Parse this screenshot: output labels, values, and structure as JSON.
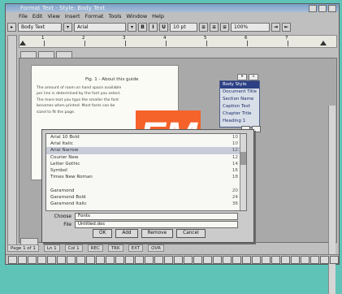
{
  "window": {
    "title": "Format Text - Style: Body Text"
  },
  "menu": [
    "File",
    "Edit",
    "View",
    "Insert",
    "Format",
    "Tools",
    "Window",
    "Help"
  ],
  "toolbar": {
    "style_value": "Body Text",
    "font_value": "Arial",
    "bold": "B",
    "italic": "I",
    "underline": "U",
    "size_value": "10 pt",
    "zoom_value": "100%"
  },
  "ruler_numbers": [
    "1",
    "2",
    "3",
    "4",
    "5",
    "6",
    "7"
  ],
  "document": {
    "caption": "Fig. 1 - About this guide",
    "body": "The amount of room on hand space available per line is determined by the font you select. The more text you type the smaller the font becomes when printed. Most fonts can be sized to fit the page.",
    "logo_text": "EM"
  },
  "style_panel": {
    "items": [
      "Body Style",
      "Document Title",
      "Section Name",
      "Caption Text",
      "Chapter Title",
      "Heading 1"
    ],
    "selected_index": 0
  },
  "dialog": {
    "rows": [
      {
        "label": "Arial 10 Bold",
        "value": "10"
      },
      {
        "label": "Arial Italic",
        "value": "10"
      },
      {
        "label": "Arial Narrow",
        "value": "12"
      },
      {
        "label": "Courier New",
        "value": "12"
      },
      {
        "label": "Letter Gothic",
        "value": "14"
      },
      {
        "label": "Symbol",
        "value": "16"
      },
      {
        "label": "Times New Roman",
        "value": "18"
      },
      {
        "label": "",
        "value": ""
      },
      {
        "label": "Garamond",
        "value": "20"
      },
      {
        "label": "Garamond Bold",
        "value": "24"
      },
      {
        "label": "Garamond Italic",
        "value": "36"
      }
    ],
    "selected_row": 2,
    "fields": [
      {
        "label": "Choose",
        "value": "Fonts"
      },
      {
        "label": "File",
        "value": "Untitled.doc"
      }
    ],
    "buttons": [
      "OK",
      "Add",
      "Remove",
      "Cancel"
    ]
  },
  "status": [
    "Page 1 of 1",
    "Ln 1",
    "Col 1",
    "REC",
    "TRK",
    "EXT",
    "OVR"
  ]
}
